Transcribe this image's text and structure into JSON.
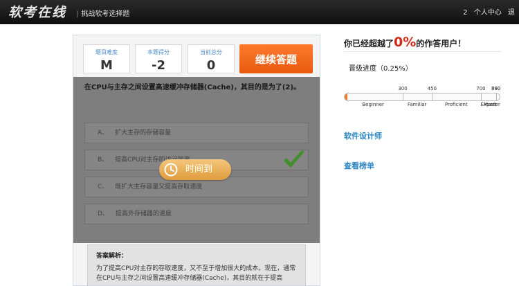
{
  "header": {
    "logo": "软考在线",
    "tagline": "挑战软考选择题",
    "badge_count": "2",
    "user_center": "个人中心",
    "exit": "退"
  },
  "stats": [
    {
      "label": "题目难度",
      "value": "M"
    },
    {
      "label": "本题得分",
      "value": "-2"
    },
    {
      "label": "当前总分",
      "value": "0"
    }
  ],
  "continue_button": "继续答题",
  "question": "在CPU与主存之间设置高速缓冲存储器(Cache)，其目的是为了(2)。",
  "options": [
    {
      "letter": "A、",
      "text": "扩大主存的存储容量"
    },
    {
      "letter": "B、",
      "text": "提高CPU对主存的访问效率"
    },
    {
      "letter": "C、",
      "text": "既扩大主存容量又提高存取速度"
    },
    {
      "letter": "D、",
      "text": "提高外存储器的速度"
    }
  ],
  "timeup_label": "时间到",
  "analysis": {
    "title": "答案解析：",
    "body": "为了提高CPU对主存的存取速度，又不至于增加很大的成本。现在，通常在CPU与主存之间设置高速缓冲存储器(Cache)，其目的就在于提高"
  },
  "beat": {
    "prefix": "你已经超越了",
    "percent": "0%",
    "suffix": "的作答用户！"
  },
  "level_progress": "晋级进度（0.25%）",
  "progress_fraction": 0.0025,
  "scale": {
    "max": 800,
    "marks": [
      {
        "value": 300,
        "label": "300"
      },
      {
        "value": 450,
        "label": "450"
      },
      {
        "value": 700,
        "label": "700"
      },
      {
        "value": 780,
        "label": "780"
      },
      {
        "value": 800,
        "label": "800"
      }
    ],
    "levels": [
      {
        "label": "Beginner",
        "center": 150
      },
      {
        "label": "Familiar",
        "center": 375
      },
      {
        "label": "Proficient",
        "center": 575
      },
      {
        "label": "Expert",
        "center": 740
      },
      {
        "label": "Master",
        "center": 790
      }
    ]
  },
  "links": {
    "category": "软件设计师",
    "leaderboard": "查看榜单"
  },
  "colors": {
    "accent_orange": "#f07a22",
    "link_blue": "#2a86c5",
    "percent_red": "#d12a1a",
    "check_green": "#3f8f2b"
  }
}
